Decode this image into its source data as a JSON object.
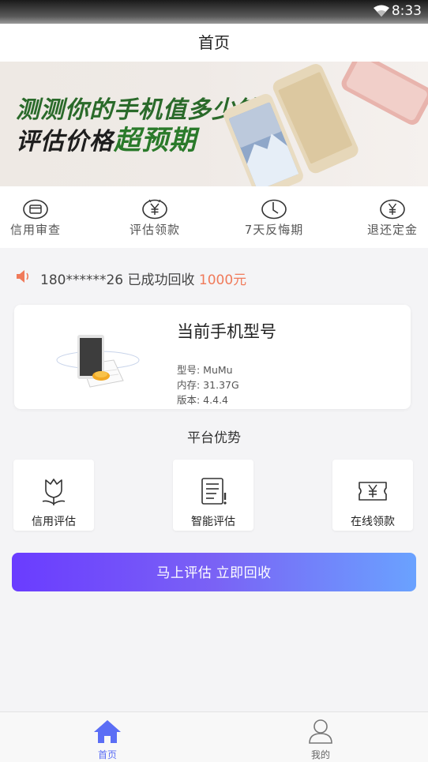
{
  "status_bar": {
    "time": "8:33"
  },
  "header": {
    "title": "首页"
  },
  "banner": {
    "line1": "测测你的手机值多少钱",
    "line2_prefix": "评估价格",
    "line2_highlight": "超预期"
  },
  "quick_nav": [
    {
      "label": "信用审查",
      "icon": "credit-card-icon"
    },
    {
      "label": "评估领款",
      "icon": "yen-coin-icon"
    },
    {
      "label": "7天反悔期",
      "icon": "clock-icon"
    },
    {
      "label": "退还定金",
      "icon": "yen-circle-icon"
    }
  ],
  "notice": {
    "text": "180******26 已成功回收",
    "amount": "1000元"
  },
  "phone_card": {
    "title": "当前手机型号",
    "model": "型号: MuMu",
    "memory": "内存: 31.37G",
    "version": "版本: 4.4.4"
  },
  "advantages": {
    "title": "平台优势",
    "items": [
      {
        "label": "信用评估",
        "icon": "tulip-icon"
      },
      {
        "label": "智能评估",
        "icon": "document-alert-icon"
      },
      {
        "label": "在线领款",
        "icon": "yen-ticket-icon"
      }
    ]
  },
  "cta": {
    "label": "马上评估 立即回收"
  },
  "tab_bar": [
    {
      "label": "首页",
      "icon": "home-icon",
      "active": true
    },
    {
      "label": "我的",
      "icon": "user-icon",
      "active": false
    }
  ],
  "colors": {
    "accent": "#5b6ef5",
    "notice_amount": "#f07a5a",
    "cta_start": "#6a3cff",
    "cta_end": "#6aa2ff"
  }
}
